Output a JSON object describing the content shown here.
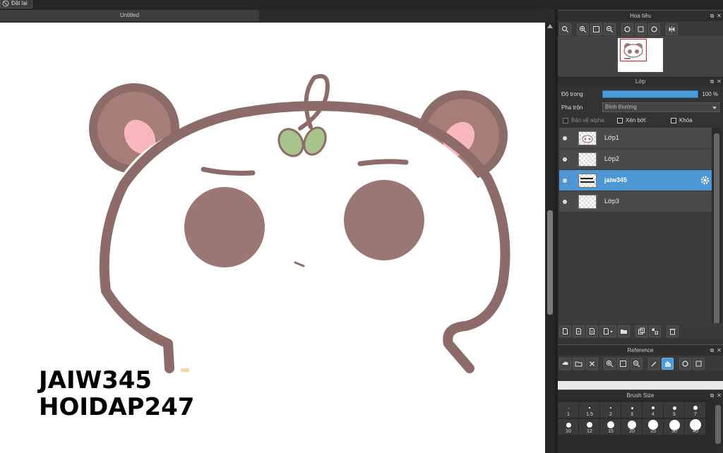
{
  "toolbar": {
    "reset_label": "Đặt lại"
  },
  "document": {
    "tab_title": "Untitled"
  },
  "canvas": {
    "watermark_line1": "JAIW345",
    "watermark_line2": "HOIDAP247"
  },
  "navigator": {
    "title": "Hoa tiêu"
  },
  "layers_panel": {
    "title": "Lớp",
    "opacity_label": "Độ trong",
    "opacity_value": "100 %",
    "opacity_level": 1.0,
    "blend_label": "Pha trộn",
    "blend_value": "Bình thường",
    "protect_alpha_label": "Bảo vệ alpha",
    "clipping_label": "Xén bớt",
    "lock_label": "Khóa",
    "layers": [
      {
        "name": "Lớp1",
        "selected": false
      },
      {
        "name": "Lớp2",
        "selected": false
      },
      {
        "name": "jaiw345",
        "selected": true
      },
      {
        "name": "Lớp3",
        "selected": false
      }
    ]
  },
  "reference": {
    "title": "Reference"
  },
  "brush_size": {
    "title": "Brush Size",
    "sizes": [
      "1",
      "1.5",
      "2",
      "3",
      "4",
      "5",
      "7",
      "10",
      "12",
      "15",
      "20",
      "25",
      "30",
      "40"
    ]
  },
  "colors": {
    "accent": "#4a9ad8",
    "panel_bg": "#333333",
    "canvas_bg": "#ffffff"
  }
}
